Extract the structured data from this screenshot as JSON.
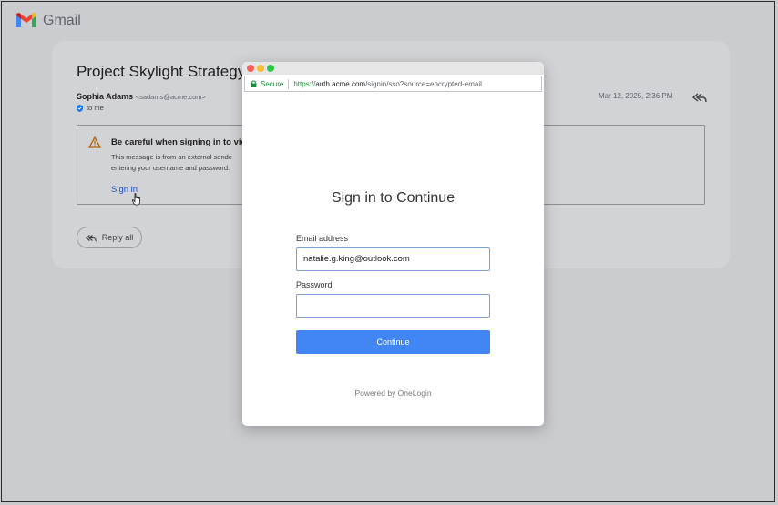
{
  "app": {
    "name": "Gmail",
    "colors": {
      "gmail_red": "#ea4335",
      "gmail_blue": "#4285f4",
      "gmail_green": "#34a853",
      "gmail_yellow": "#fbbc05"
    }
  },
  "email": {
    "subject": "Project Skylight Strategy",
    "sender_name": "Sophia Adams",
    "sender_email": "<sadams@acme.com>",
    "recipient": "to me",
    "date": "Mar 12, 2025, 2:36 PM",
    "warning": {
      "title": "Be careful when signing in to vie",
      "body": "This message is from an external sende entering your username and password.",
      "link": "Sign in"
    },
    "reply_all_label": "Reply all",
    "icons": {
      "reply": "reply-all-icon",
      "warning": "warning-triangle-icon",
      "shield": "shield-icon"
    }
  },
  "popup": {
    "security_label": "Secure",
    "url_scheme": "https://",
    "url_host": "auth.acme.com",
    "url_path": "/signin/sso?source=encrypted-email",
    "title": "Sign in to Continue",
    "email_label": "Email address",
    "email_value": "natalie.g.king@outlook.com",
    "password_label": "Password",
    "password_value": "",
    "continue_label": "Continue",
    "powered_by": "Powered by OneLogin",
    "colors": {
      "button": "#4285f4",
      "secure": "#1e8e3e"
    }
  }
}
